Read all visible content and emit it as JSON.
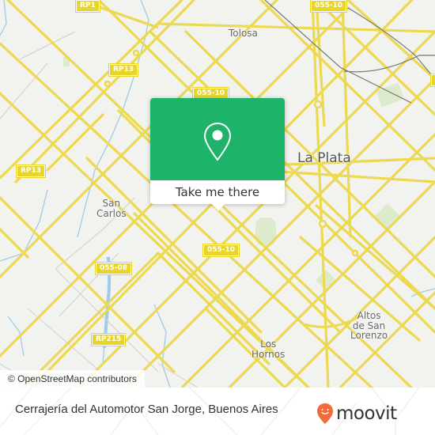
{
  "map": {
    "places": {
      "tolosa": "Tolosa",
      "la_plata": "La Plata",
      "san_carlos_line1": "San",
      "san_carlos_line2": "Carlos",
      "los_hornos_line1": "Los",
      "los_hornos_line2": "Hornos",
      "altos_line1": "Altos",
      "altos_line2": "de San",
      "altos_line3": "Lorenzo"
    },
    "road_shields": {
      "rp1": "RP1",
      "rp13_a": "RP13",
      "rp13_b": "RP13",
      "r05510_top": "055-10",
      "r05510_mid": "055-10",
      "r05510_low": "055-10",
      "r05508": "055-08",
      "rp215": "RP215"
    },
    "attribution": "© OpenStreetMap contributors"
  },
  "popup": {
    "icon": "map-pin-icon",
    "button_label": "Take me there",
    "accent_color": "#1db46a"
  },
  "footer": {
    "title": "Cerrajería del Automotor San Jorge, Buenos Aires",
    "brand": "moovit",
    "brand_icon": "moovit-smiley-pin-icon",
    "brand_color": "#f26b3a"
  }
}
